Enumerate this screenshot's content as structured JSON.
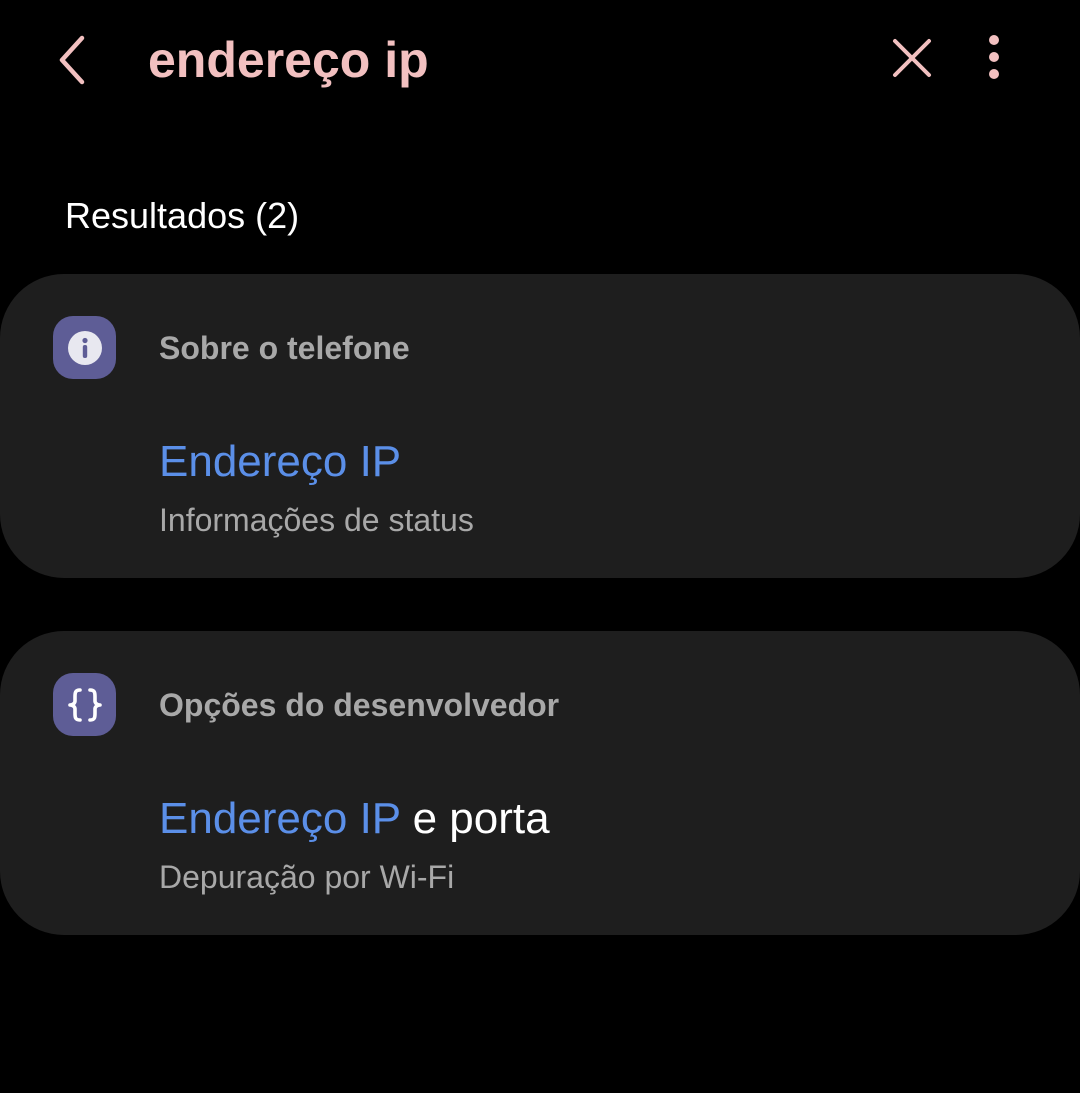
{
  "colors": {
    "background": "#000000",
    "query_accent": "#f2c0c0",
    "match_highlight": "#5b8fe8",
    "card_background": "#1e1e1e",
    "category_icon_background": "#5e5d96",
    "secondary_text": "#a8a8a8"
  },
  "topbar": {
    "back_icon": "chevron-left-icon",
    "search_query": "endereço ip",
    "clear_icon": "close-icon",
    "more_icon": "more-vertical-icon"
  },
  "results": {
    "header": "Resultados (2)",
    "items": [
      {
        "category_icon": "info-icon",
        "category": "Sobre o telefone",
        "title_match": "Endereço IP",
        "title_rest": "",
        "subtitle": "Informações de status"
      },
      {
        "category_icon": "code-braces-icon",
        "category": "Opções do desenvolvedor",
        "title_match": "Endereço IP",
        "title_rest": " e porta",
        "subtitle": "Depuração por Wi-Fi"
      }
    ]
  }
}
